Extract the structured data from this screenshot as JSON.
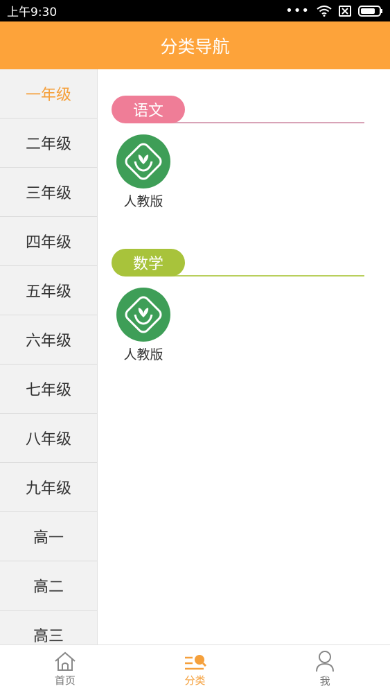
{
  "status_bar": {
    "time": "上午9:30",
    "dots": "•••"
  },
  "header": {
    "title": "分类导航"
  },
  "sidebar": {
    "items": [
      {
        "label": "一年级",
        "active": true
      },
      {
        "label": "二年级"
      },
      {
        "label": "三年级"
      },
      {
        "label": "四年级"
      },
      {
        "label": "五年级"
      },
      {
        "label": "六年级"
      },
      {
        "label": "七年级"
      },
      {
        "label": "八年级"
      },
      {
        "label": "九年级"
      },
      {
        "label": "高一"
      },
      {
        "label": "高二"
      },
      {
        "label": "高三"
      }
    ]
  },
  "content": {
    "sections": [
      {
        "title": "语文",
        "color": "#ef7d97",
        "books": [
          {
            "label": "人教版",
            "icon": "textbook-publisher-icon"
          }
        ]
      },
      {
        "title": "数学",
        "color": "#a8c33b",
        "books": [
          {
            "label": "人教版",
            "icon": "textbook-publisher-icon"
          }
        ]
      }
    ]
  },
  "tabbar": {
    "items": [
      {
        "label": "首页",
        "icon": "home-icon"
      },
      {
        "label": "分类",
        "icon": "category-search-icon",
        "active": true
      },
      {
        "label": "我",
        "icon": "user-icon"
      }
    ]
  },
  "colors": {
    "accent": "#fda33a",
    "active_text": "#f5a03c",
    "book_green": "#3e9e57"
  }
}
